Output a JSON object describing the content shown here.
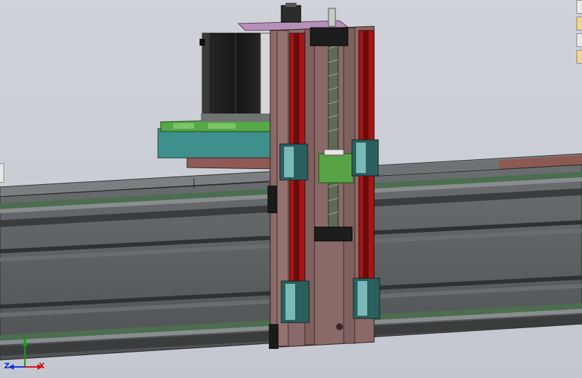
{
  "viewport": {
    "background": "#c9ccd4"
  },
  "side_toolbar": {
    "tabs": [
      "view-orientation-tab",
      "display-style-tab",
      "appearance-tab",
      "scene-tab"
    ]
  },
  "triad": {
    "x_label": "X",
    "y_label": "Y",
    "z_label": "Z",
    "x_color": "#d01010",
    "y_color": "#10a010",
    "z_color": "#1030d0"
  },
  "model_colors": {
    "frame_plate": "#8a6a68",
    "rail_red": "#a31616",
    "motor": "#202020",
    "green_carriage": "#57a345",
    "teal_plate": "#3f8f8c",
    "top_plate": "#b690b8",
    "extrusion": "#5e6163"
  }
}
